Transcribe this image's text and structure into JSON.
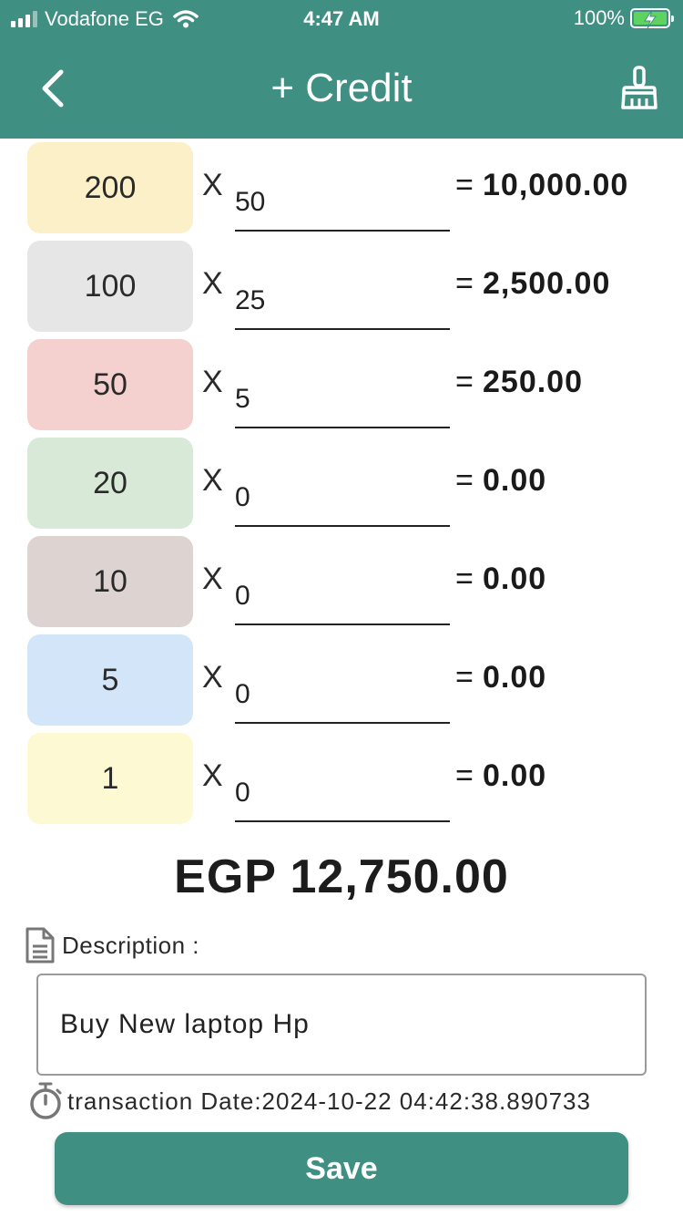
{
  "status_bar": {
    "carrier": "Vodafone EG",
    "time": "4:47 AM",
    "battery": "100%"
  },
  "header": {
    "title": "+ Credit",
    "back_icon": "chevron-left-icon",
    "clear_icon": "broom-icon",
    "background_color": "#3f9082"
  },
  "rows": [
    {
      "denomination": "200",
      "multiplier": "X",
      "quantity": "50",
      "equals": "=",
      "subtotal": "10,000.00",
      "color": "#fbf0c7"
    },
    {
      "denomination": "100",
      "multiplier": "X",
      "quantity": "25",
      "equals": "=",
      "subtotal": "2,500.00",
      "color": "#e6e6e6"
    },
    {
      "denomination": "50",
      "multiplier": "X",
      "quantity": "5",
      "equals": "=",
      "subtotal": "250.00",
      "color": "#f4d1cf"
    },
    {
      "denomination": "20",
      "multiplier": "X",
      "quantity": "0",
      "equals": "=",
      "subtotal": "0.00",
      "color": "#d8ead7"
    },
    {
      "denomination": "10",
      "multiplier": "X",
      "quantity": "0",
      "equals": "=",
      "subtotal": "0.00",
      "color": "#ddd4d1"
    },
    {
      "denomination": "5",
      "multiplier": "X",
      "quantity": "0",
      "equals": "=",
      "subtotal": "0.00",
      "color": "#d3e5f8"
    },
    {
      "denomination": "1",
      "multiplier": "X",
      "quantity": "0",
      "equals": "=",
      "subtotal": "0.00",
      "color": "#fdf9d3"
    }
  ],
  "total": "EGP 12,750.00",
  "description": {
    "label": "Description :",
    "value": "Buy New laptop Hp",
    "icon": "document-icon"
  },
  "transaction": {
    "text": "transaction Date:2024-10-22 04:42:38.890733",
    "icon": "stopwatch-icon"
  },
  "save_button": {
    "label": "Save",
    "color": "#3f9082"
  }
}
